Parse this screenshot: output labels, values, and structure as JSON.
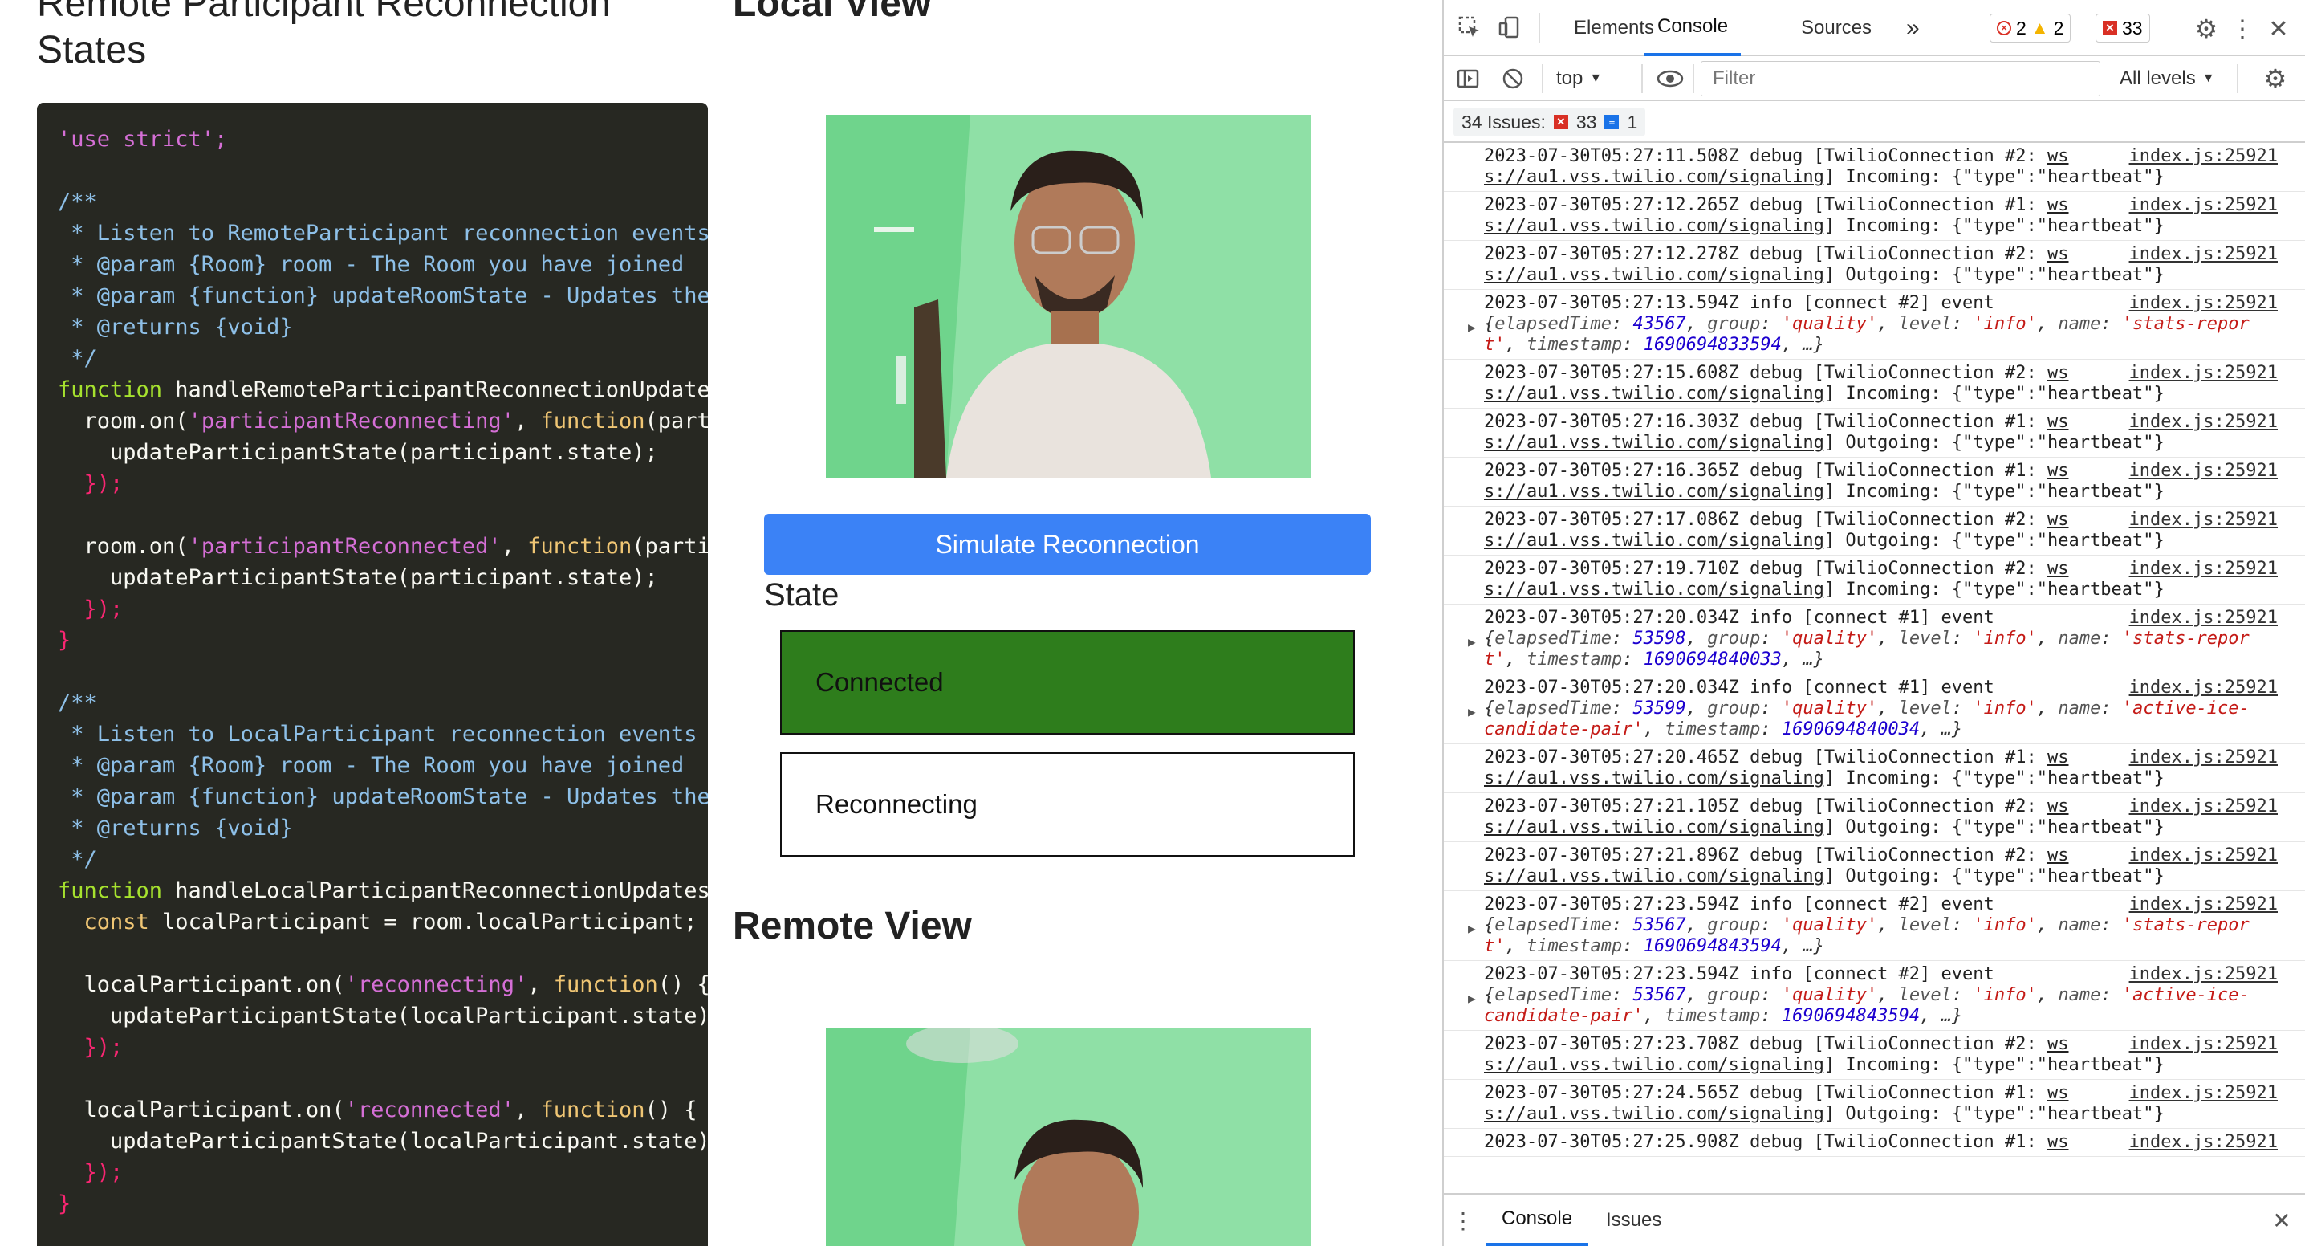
{
  "page": {
    "title_left": "Remote Participant Reconnection States",
    "title_local": "Local View",
    "title_remote": "Remote View",
    "simulate_button": "Simulate Reconnection",
    "state_heading": "State",
    "state_connected": "Connected",
    "state_reconnecting": "Reconnecting"
  },
  "code": {
    "line1": "'use strict';",
    "l_c1": "/**",
    "l_c2": " * Listen to RemoteParticipant reconnection events a",
    "l_c3": " * @param {Room} room - The Room you have joined",
    "l_c4": " * @param {function} updateRoomState - Updates the a",
    "l_c5": " * @returns {void}",
    "l_c6": " */",
    "l_f1_kw": "function",
    "l_f1_name": " handleRemoteParticipantReconnectionUpdates(",
    "l_r1a": "  room.on(",
    "l_r1b": "'participantReconnecting'",
    "l_r1c": ", ",
    "l_r1d": "function",
    "l_r1e": "(partic",
    "l_u1": "    updateParticipantState(participant.state);",
    "l_close1": "  });",
    "l_r2a": "  room.on(",
    "l_r2b": "'participantReconnected'",
    "l_r2c": ", ",
    "l_r2d": "function",
    "l_r2e": "(partici",
    "l_u2": "    updateParticipantState(participant.state);",
    "l_close2": "  });",
    "l_brace1": "}",
    "l_d1": "/**",
    "l_d2": " * Listen to LocalParticipant reconnection events an",
    "l_d3": " * @param {Room} room - The Room you have joined",
    "l_d4": " * @param {function} updateRoomState - Updates the a",
    "l_d5": " * @returns {void}",
    "l_d6": " */",
    "l_f2_kw": "function",
    "l_f2_name": " handleLocalParticipantReconnectionUpdates(r",
    "l_const_kw": "  const",
    "l_const_rest": " localParticipant = room.localParticipant;",
    "l_lp1a": "  localParticipant.on(",
    "l_lp1b": "'reconnecting'",
    "l_lp1c": ", ",
    "l_lp1d": "function",
    "l_lp1e": "() {",
    "l_u3": "    updateParticipantState(localParticipant.state);",
    "l_close3": "  });",
    "l_lp2a": "  localParticipant.on(",
    "l_lp2b": "'reconnected'",
    "l_lp2c": ", ",
    "l_lp2d": "function",
    "l_lp2e": "() {",
    "l_u4": "    updateParticipantState(localParticipant.state);",
    "l_close4": "  });",
    "l_brace2": "}"
  },
  "devtools": {
    "tabs": [
      "Elements",
      "Console",
      "Sources"
    ],
    "more_tabs": "»",
    "errors_count": "2",
    "warnings_count": "2",
    "issues_badge_count": "33",
    "context": "top",
    "filter_placeholder": "Filter",
    "levels": "All levels",
    "issues_label": "34 Issues:",
    "issues_errors": "33",
    "issues_info": "1",
    "drawer_tabs": [
      "Console",
      "Issues"
    ],
    "messages": [
      {
        "l1": "2023-07-30T05:27:11.508Z debug [TwilioConnection #2: ",
        "ws": "ws",
        "l2a": "s://au1.vss.twilio.com/signaling",
        "l2b": "] Incoming: {\"type\":\"heartbeat\"}",
        "src": "index.js:25921"
      },
      {
        "l1": "2023-07-30T05:27:12.265Z debug [TwilioConnection #1: ",
        "ws": "ws",
        "l2a": "s://au1.vss.twilio.com/signaling",
        "l2b": "] Incoming: {\"type\":\"heartbeat\"}",
        "src": "index.js:25921"
      },
      {
        "l1": "2023-07-30T05:27:12.278Z debug [TwilioConnection #2: ",
        "ws": "ws",
        "l2a": "s://au1.vss.twilio.com/signaling",
        "l2b": "] Outgoing: {\"type\":\"heartbeat\"}",
        "src": "index.js:25921"
      },
      {
        "l1": "2023-07-30T05:27:13.594Z info [connect #2] event",
        "obj": [
          "43567",
          "'quality'",
          "'info'",
          "'stats-repor",
          "t'",
          "1690694833594"
        ],
        "src": "index.js:25921"
      },
      {
        "l1": "2023-07-30T05:27:15.608Z debug [TwilioConnection #2: ",
        "ws": "ws",
        "l2a": "s://au1.vss.twilio.com/signaling",
        "l2b": "] Incoming: {\"type\":\"heartbeat\"}",
        "src": "index.js:25921"
      },
      {
        "l1": "2023-07-30T05:27:16.303Z debug [TwilioConnection #1: ",
        "ws": "ws",
        "l2a": "s://au1.vss.twilio.com/signaling",
        "l2b": "] Outgoing: {\"type\":\"heartbeat\"}",
        "src": "index.js:25921"
      },
      {
        "l1": "2023-07-30T05:27:16.365Z debug [TwilioConnection #1: ",
        "ws": "ws",
        "l2a": "s://au1.vss.twilio.com/signaling",
        "l2b": "] Incoming: {\"type\":\"heartbeat\"}",
        "src": "index.js:25921"
      },
      {
        "l1": "2023-07-30T05:27:17.086Z debug [TwilioConnection #2: ",
        "ws": "ws",
        "l2a": "s://au1.vss.twilio.com/signaling",
        "l2b": "] Outgoing: {\"type\":\"heartbeat\"}",
        "src": "index.js:25921"
      },
      {
        "l1": "2023-07-30T05:27:19.710Z debug [TwilioConnection #2: ",
        "ws": "ws",
        "l2a": "s://au1.vss.twilio.com/signaling",
        "l2b": "] Incoming: {\"type\":\"heartbeat\"}",
        "src": "index.js:25921"
      },
      {
        "l1": "2023-07-30T05:27:20.034Z info [connect #1] event",
        "obj": [
          "53598",
          "'quality'",
          "'info'",
          "'stats-repor",
          "t'",
          "1690694840033"
        ],
        "src": "index.js:25921"
      },
      {
        "l1": "2023-07-30T05:27:20.034Z info [connect #1] event",
        "obj2": [
          "53599",
          "'quality'",
          "'info'",
          "'active-ice-",
          "candidate-pair'",
          "1690694840034"
        ],
        "src": "index.js:25921"
      },
      {
        "l1": "2023-07-30T05:27:20.465Z debug [TwilioConnection #1: ",
        "ws": "ws",
        "l2a": "s://au1.vss.twilio.com/signaling",
        "l2b": "] Incoming: {\"type\":\"heartbeat\"}",
        "src": "index.js:25921"
      },
      {
        "l1": "2023-07-30T05:27:21.105Z debug [TwilioConnection #2: ",
        "ws": "ws",
        "l2a": "s://au1.vss.twilio.com/signaling",
        "l2b": "] Outgoing: {\"type\":\"heartbeat\"}",
        "src": "index.js:25921"
      },
      {
        "l1": "2023-07-30T05:27:21.896Z debug [TwilioConnection #2: ",
        "ws": "ws",
        "l2a": "s://au1.vss.twilio.com/signaling",
        "l2b": "] Outgoing: {\"type\":\"heartbeat\"}",
        "src": "index.js:25921"
      },
      {
        "l1": "2023-07-30T05:27:23.594Z info [connect #2] event",
        "obj": [
          "53567",
          "'quality'",
          "'info'",
          "'stats-repor",
          "t'",
          "1690694843594"
        ],
        "src": "index.js:25921"
      },
      {
        "l1": "2023-07-30T05:27:23.594Z info [connect #2] event",
        "obj2": [
          "53567",
          "'quality'",
          "'info'",
          "'active-ice-",
          "candidate-pair'",
          "1690694843594"
        ],
        "src": "index.js:25921"
      },
      {
        "l1": "2023-07-30T05:27:23.708Z debug [TwilioConnection #2: ",
        "ws": "ws",
        "l2a": "s://au1.vss.twilio.com/signaling",
        "l2b": "] Incoming: {\"type\":\"heartbeat\"}",
        "src": "index.js:25921"
      },
      {
        "l1": "2023-07-30T05:27:24.565Z debug [TwilioConnection #1: ",
        "ws": "ws",
        "l2a": "s://au1.vss.twilio.com/signaling",
        "l2b": "] Outgoing: {\"type\":\"heartbeat\"}",
        "src": "index.js:25921"
      },
      {
        "l1": "2023-07-30T05:27:25.908Z debug [TwilioConnection #1: ",
        "ws": "ws",
        "l2a": "",
        "l2b": "",
        "src": "index.js:25921"
      }
    ]
  },
  "colors": {
    "code_bg": "#272822",
    "button_blue": "#3b82f6",
    "connected_green": "#2e7d1c",
    "devtools_active": "#1a73e8",
    "error_red": "#d93025",
    "warning_yellow": "#f4b400"
  },
  "icons": [
    "inspect-icon",
    "device-toggle-icon",
    "settings-icon",
    "kebab-menu-icon",
    "close-icon",
    "sidebar-icon",
    "clear-console-icon",
    "eye-icon",
    "gear-icon"
  ]
}
